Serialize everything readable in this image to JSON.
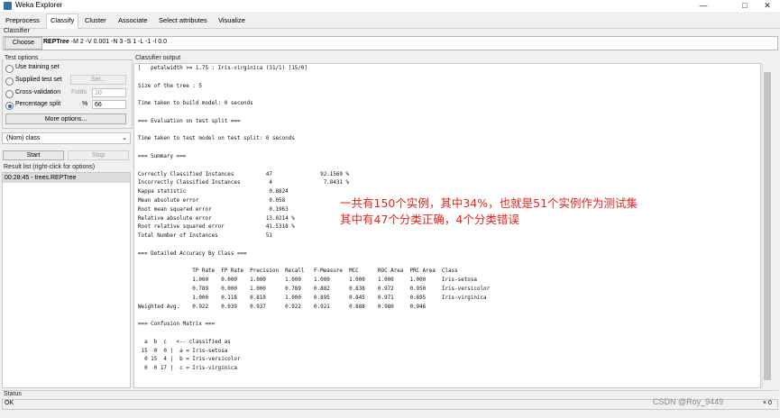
{
  "window": {
    "title": "Weka Explorer",
    "minimize": "—",
    "maximize": "□",
    "close": "✕"
  },
  "tabs": [
    "Preprocess",
    "Classify",
    "Cluster",
    "Associate",
    "Select attributes",
    "Visualize"
  ],
  "active_tab": "Classify",
  "classifier": {
    "section_label": "Classifier",
    "choose_label": "Choose",
    "name": "REPTree",
    "options": " -M 2 -V 0.001 -N 3 -S 1 -L -1 -I 0.0"
  },
  "test_options": {
    "section_label": "Test options",
    "use_training_set": "Use training set",
    "supplied_test_set": "Supplied test set",
    "set_button": "Set...",
    "cross_validation": "Cross-validation",
    "folds_label": "Folds",
    "folds_value": "10",
    "percentage_split": "Percentage split",
    "percent_label": "%",
    "percent_value": "66",
    "selected": "percentage_split",
    "more_options": "More options..."
  },
  "class_select": {
    "value": "(Nom) class"
  },
  "actions": {
    "start": "Start",
    "stop": "Stop"
  },
  "result_list": {
    "label": "Result list (right-click for options)",
    "items": [
      "00:28:45 - trees.REPTree"
    ]
  },
  "output": {
    "section_label": "Classifier output",
    "lines": [
      "|   petalwidth >= 1.75 : Iris-virginica (31/1) [15/0]",
      "",
      "Size of the tree : 5",
      "",
      "Time taken to build model: 0 seconds",
      "",
      "=== Evaluation on test split ===",
      "",
      "Time taken to test model on test split: 0 seconds",
      "",
      "=== Summary ===",
      "",
      "Correctly Classified Instances          47               92.1569 %",
      "Incorrectly Classified Instances         4                7.8431 %",
      "Kappa statistic                          0.8824",
      "Mean absolute error                      0.058",
      "Root mean squared error                  0.1963",
      "Relative absolute error                 13.0214 %",
      "Root relative squared error             41.5318 %",
      "Total Number of Instances               51",
      "",
      "=== Detailed Accuracy By Class ===",
      "",
      "                 TP Rate  FP Rate  Precision  Recall   F-Measure  MCC      ROC Area  PRC Area  Class",
      "                 1.000    0.000    1.000      1.000    1.000      1.000    1.000     1.000     Iris-setosa",
      "                 0.789    0.000    1.000      0.789    0.882      0.838    0.972     0.950     Iris-versicolor",
      "                 1.000    0.118    0.810      1.000    0.895      0.845    0.971     0.895     Iris-virginica",
      "Weighted Avg.    0.922    0.039    0.937      0.922    0.921      0.888    0.980     0.946",
      "",
      "=== Confusion Matrix ===",
      "",
      "  a  b  c   <-- classified as",
      " 15  0  0 |  a = Iris-setosa",
      "  0 15  4 |  b = Iris-versicolor",
      "  0  0 17 |  c = Iris-virginica"
    ]
  },
  "annotation": {
    "line1": "一共有150个实例，其中34%，也就是51个实例作为测试集",
    "line2": "其中有47个分类正确，4个分类错误"
  },
  "status": {
    "label": "Status",
    "text": "OK",
    "right_count": "× 0"
  },
  "watermark": "CSDN @Roy_9449",
  "colors": {
    "annotation": "#e8231f",
    "radio_selected": "#1f63c8",
    "result_selected": "#dcdcdc"
  }
}
